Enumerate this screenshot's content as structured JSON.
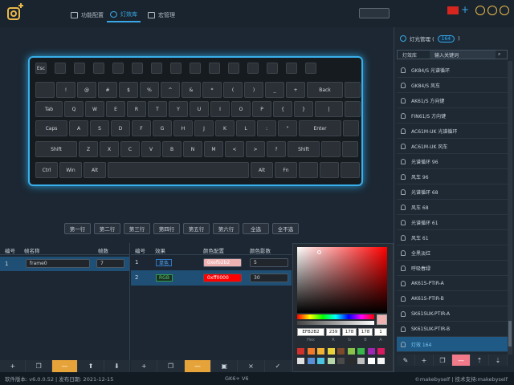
{
  "nav": {
    "tabs": [
      {
        "label": "功能配置"
      },
      {
        "label": "灯效库"
      },
      {
        "label": "宏管理"
      }
    ],
    "accent": "#39a8e6"
  },
  "keyboard": {
    "row1": [
      "Esc",
      "",
      "",
      "",
      "",
      "",
      "",
      "",
      "",
      "",
      "",
      "",
      "",
      "",
      ""
    ],
    "row2": [
      "",
      "!",
      "@",
      "#",
      "$",
      "%",
      "^",
      "&",
      "*",
      "(",
      ")",
      "_",
      "+",
      "Back",
      ""
    ],
    "row3": [
      "Tab",
      "Q",
      "W",
      "E",
      "R",
      "T",
      "Y",
      "U",
      "I",
      "O",
      "P",
      "{",
      "}",
      "|",
      ""
    ],
    "row4": [
      "Caps",
      "A",
      "S",
      "D",
      "F",
      "G",
      "H",
      "J",
      "K",
      "L",
      ":",
      "\"",
      "Enter",
      ""
    ],
    "row5": [
      "Shift",
      "Z",
      "X",
      "C",
      "V",
      "B",
      "N",
      "M",
      "<",
      ">",
      "?",
      "Shift",
      "",
      ""
    ],
    "row6": [
      "Ctrl",
      "Win",
      "Alt",
      "",
      "Alt",
      "Fn",
      "",
      "",
      ""
    ]
  },
  "row_buttons": [
    "第一行",
    "第二行",
    "第三行",
    "第四行",
    "第五行",
    "第六行",
    "全选",
    "全不选"
  ],
  "frames": {
    "headers": [
      "编号",
      "帧名称",
      "帧数"
    ],
    "rows": [
      {
        "id": "1",
        "name": "frame0",
        "count": "7"
      }
    ]
  },
  "effects": {
    "headers": [
      "编号",
      "效果",
      "颜色配置",
      "颜色影数"
    ],
    "rows": [
      {
        "id": "1",
        "effect": "单色",
        "color": "0xefb2b2",
        "value": "5",
        "color_hex": "#efb2b2"
      },
      {
        "id": "2",
        "effect": "RGB",
        "color": "0xff0000",
        "value": "30",
        "color_hex": "#ff0000"
      }
    ]
  },
  "picker": {
    "hex": "EFB2B2",
    "r": "239",
    "g": "178",
    "b": "178",
    "a": "1",
    "labels": [
      "Hex",
      "R",
      "G",
      "B",
      "A"
    ],
    "swatches": [
      "#d0312d",
      "#f07a2a",
      "#f2b233",
      "#e8d33a",
      "#7c4a2a",
      "#8bc34a",
      "#39b54a",
      "#9c27b0",
      "#d81b60",
      "#e0e0e0",
      "#5a8ed6",
      "#4cc3e0",
      "#b6d7a8",
      "#4a4a4a",
      "#2b2b2b",
      "#bfbfbf",
      "#ffffff",
      "#f5f5f5"
    ]
  },
  "lighting": {
    "title": "灯光管理 (",
    "count": "164",
    "title_end": ")",
    "tab1": "灯效库",
    "search_placeholder": "输入关键词",
    "items": [
      "GK84/S 光谱循环",
      "GK84/S 风车",
      "AK61/S 方向键",
      "FIN61/S 方向键",
      "AC61M-UK 光谱循环",
      "AC61M-UK 风车",
      "光谱循环 96",
      "风车 96",
      "光谱循环 68",
      "风车 68",
      "光谱循环 61",
      "风车 61",
      "全黑淡红",
      "呼吸春绿",
      "AK61S-PTIR-A",
      "AK61S-PTIR-B",
      "SK61SUK-PTIR-A",
      "SK61SUK-PTIR-B",
      "灯效 164"
    ]
  },
  "status": {
    "version": "软件版本: v6.0.0.52 | 发布日期: 2021-12-15",
    "model": "GK6+ V6",
    "copyright": "©makebyself | 技术支持:makebyself"
  }
}
